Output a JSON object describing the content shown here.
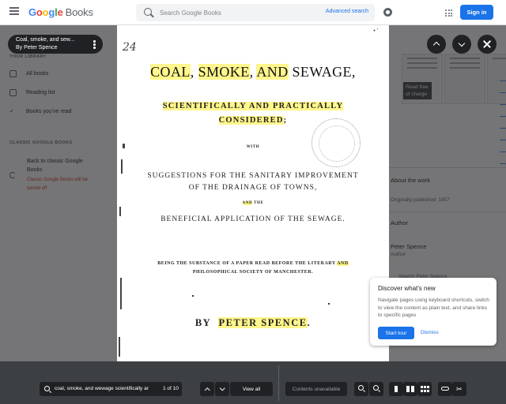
{
  "header": {
    "logo_google": [
      "G",
      "o",
      "o",
      "g",
      "l",
      "e"
    ],
    "logo_books": "Books",
    "search_placeholder": "Search Google Books",
    "advanced_search": "Advanced search",
    "signin": "Sign in"
  },
  "sidebar": {
    "section_your_library": "YOUR LIBRARY",
    "items": [
      {
        "label": "All books",
        "icon": "library-icon"
      },
      {
        "label": "Reading list",
        "icon": "bookmark-icon"
      },
      {
        "label": "Books you've read",
        "icon": "check-icon"
      }
    ],
    "section_classic": "CLASSIC GOOGLE BOOKS",
    "classic_link": "Back to classic Google Books",
    "classic_warning": "Classic Google Books will be turned off"
  },
  "title_pill": {
    "title": "Coal, smoke, and sew...",
    "author": "By Peter Spence"
  },
  "book_page": {
    "hand_number": "24",
    "corner_mark": "• '",
    "title_words": [
      "COAL",
      "SMOKE",
      "AND",
      "SEWAGE"
    ],
    "line2a": "SCIENTIFICALLY AND PRACTICALLY",
    "line2b": "CONSIDERED",
    "with": "WITH",
    "line3a": "SUGGESTIONS FOR THE SANITARY IMPROVEMENT",
    "line3b": "OF THE DRAINAGE OF TOWNS,",
    "and_the": [
      "AND",
      "THE"
    ],
    "line4": "BENEFICIAL APPLICATION OF THE SEWAGE.",
    "line5a_pre": "BEING THE SUBSTANCE OF A PAPER READ BEFORE THE LITERARY",
    "line5a_and": "AND",
    "line5b": "PHILOSOPHICAL SOCIETY OF MANCHESTER.",
    "by": "BY",
    "author": "PETER SPENCE",
    "highlight_color": "#fff68c"
  },
  "right_panel": {
    "badge": "Read free of charge",
    "about_heading": "About the work",
    "published": "Originally published: 1857",
    "author_heading": "Author",
    "author_name": "Peter Spence",
    "author_role": "Author",
    "search_chip": "Search Peter Spence"
  },
  "popup": {
    "title": "Discover what's new",
    "body": "Navigate pages using keyboard shortcuts, switch to view the content as plain text, and share links to specific pages",
    "start": "Start tour",
    "dismiss": "Dismiss"
  },
  "toolbar": {
    "query": "coal, smoke, and wewage scientifically ar",
    "count": "1 of 10",
    "view_all": "View all",
    "contents": "Contents unavailable"
  },
  "colors": {
    "accent": "#1a73e8",
    "toolbar_bg": "#3c4043",
    "dark_btn": "#202124",
    "warning": "#d93025"
  }
}
